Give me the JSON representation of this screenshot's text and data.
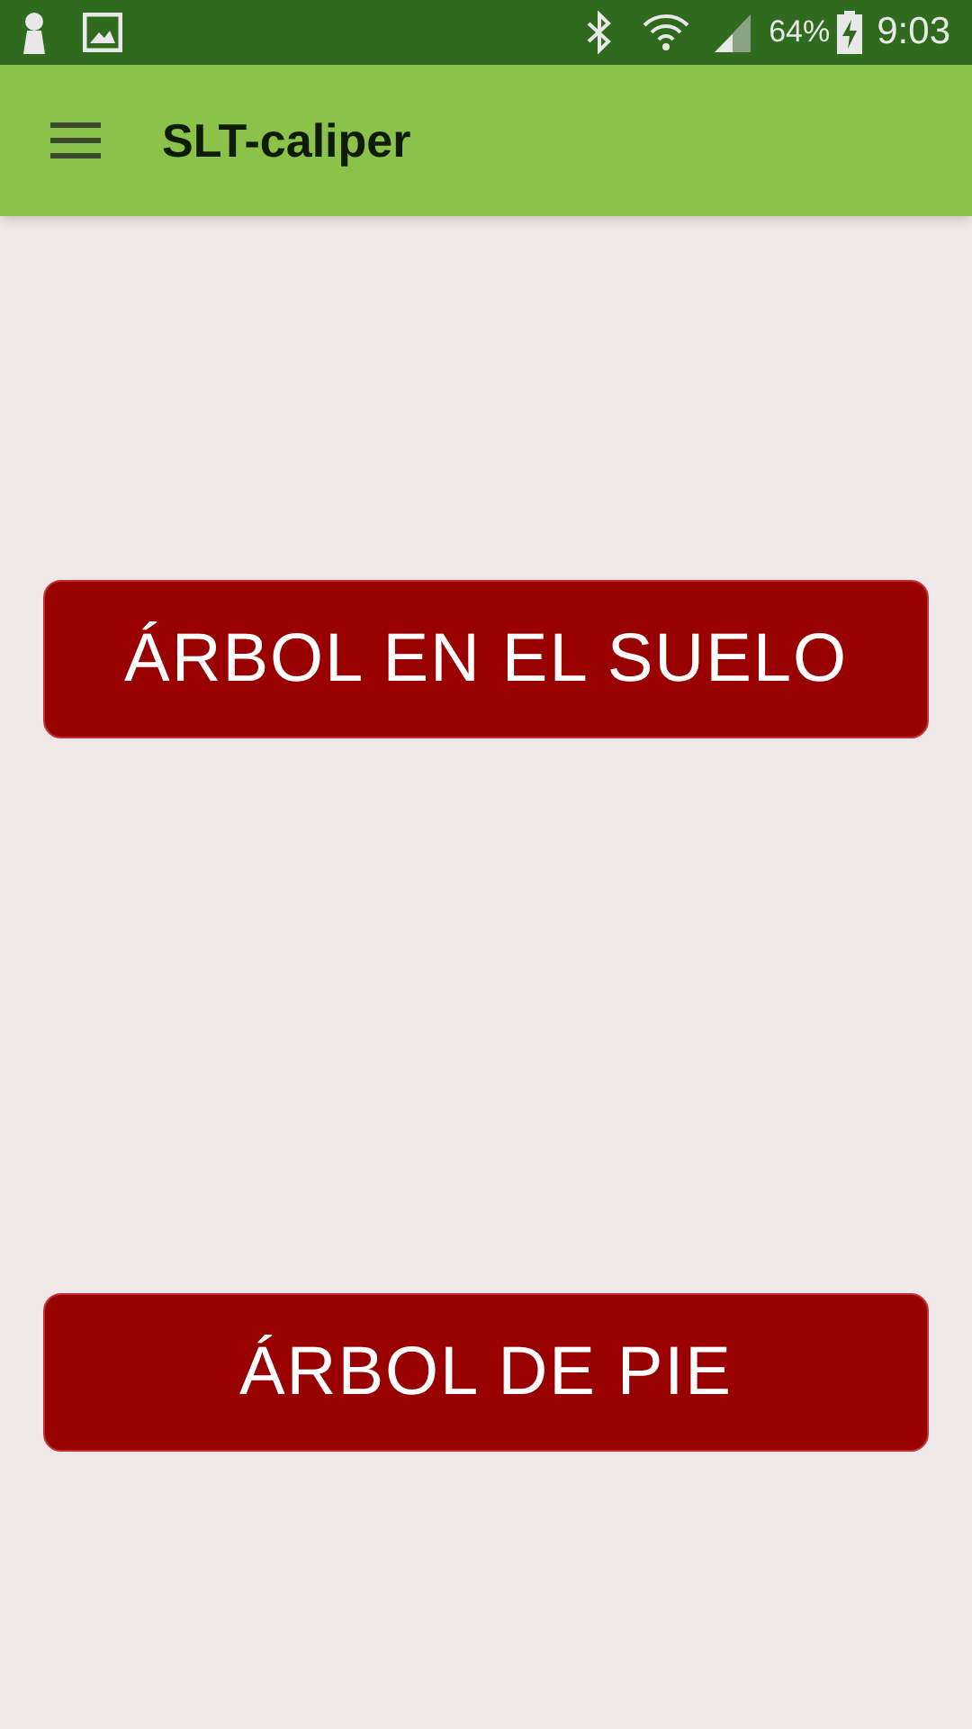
{
  "status_bar": {
    "battery": "64%",
    "time": "9:03"
  },
  "app_bar": {
    "title": "SLT-caliper"
  },
  "buttons": [
    {
      "label": "ÁRBOL EN EL SUELO"
    },
    {
      "label": "ÁRBOL DE PIE"
    }
  ]
}
